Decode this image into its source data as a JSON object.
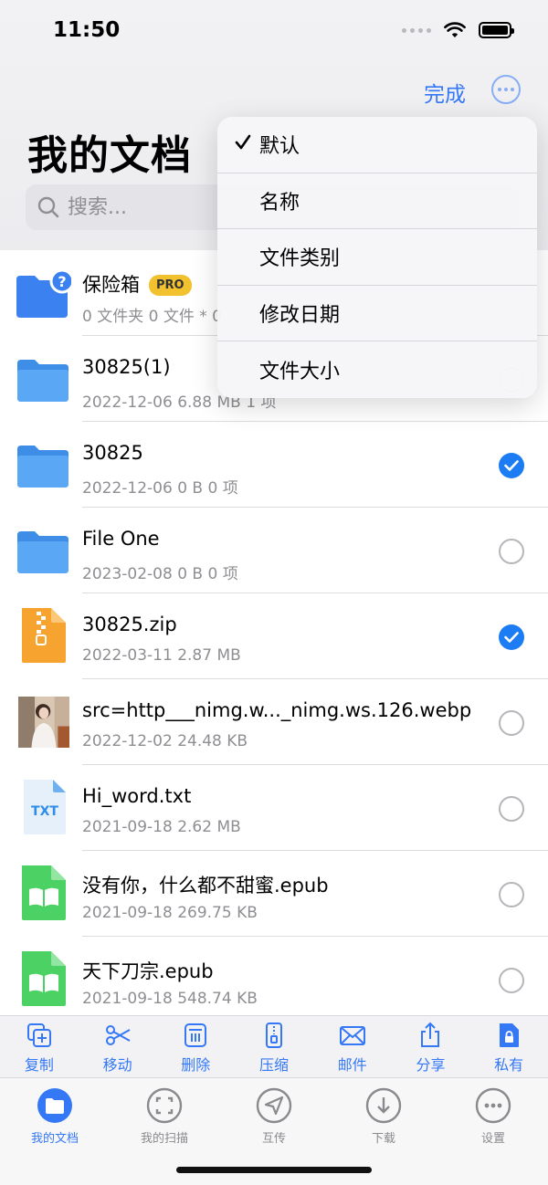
{
  "status_bar": {
    "time": "11:50"
  },
  "header": {
    "done_label": "完成",
    "title": "我的文档",
    "search_placeholder": "搜索..."
  },
  "sort_menu": {
    "items": [
      {
        "label": "默认",
        "checked": true
      },
      {
        "label": "名称",
        "checked": false
      },
      {
        "label": "文件类别",
        "checked": false
      },
      {
        "label": "修改日期",
        "checked": false
      },
      {
        "label": "文件大小",
        "checked": false
      }
    ]
  },
  "files": [
    {
      "name": "保险箱",
      "badge": "PRO",
      "meta": "0 文件夹 0 文件 * 0",
      "icon": "vault-folder-icon"
    },
    {
      "name": "30825(1)",
      "meta": "2022-12-06 6.88 MB  1 项",
      "icon": "folder-icon",
      "selected": false
    },
    {
      "name": "30825",
      "meta": "2022-12-06 0 B  0 项",
      "icon": "folder-icon",
      "selected": true
    },
    {
      "name": "File One",
      "meta": "2023-02-08 0 B  0 项",
      "icon": "folder-icon",
      "selected": false
    },
    {
      "name": "30825.zip",
      "meta": "2022-03-11 2.87 MB",
      "icon": "zip-file-icon",
      "selected": true
    },
    {
      "name": "src=http___nimg.w..._nimg.ws.126.webp",
      "meta": "2022-12-02 24.48 KB",
      "icon": "image-thumbnail",
      "selected": false
    },
    {
      "name": "Hi_word.txt",
      "meta": "2021-09-18 2.62 MB",
      "icon": "txt-file-icon",
      "icon_text": "TXT",
      "selected": false
    },
    {
      "name": "没有你，什么都不甜蜜.epub",
      "meta": "2021-09-18 269.75 KB",
      "icon": "epub-file-icon",
      "selected": false
    },
    {
      "name": "天下刀宗.epub",
      "meta": "2021-09-18 548.74 KB",
      "icon": "epub-file-icon",
      "selected": false
    }
  ],
  "action_bar": {
    "copy": "复制",
    "move": "移动",
    "delete": "删除",
    "compress": "压缩",
    "mail": "邮件",
    "share": "分享",
    "private": "私有"
  },
  "tab_bar": {
    "my_docs": "我的文档",
    "my_scans": "我的扫描",
    "transfer": "互传",
    "downloads": "下载",
    "settings": "设置",
    "active": "my_docs"
  },
  "colors": {
    "accent": "#3478f6",
    "folder": "#4a9df3",
    "zip": "#f7a330",
    "epub": "#4cd264",
    "pro_badge": "#f2c12e"
  }
}
